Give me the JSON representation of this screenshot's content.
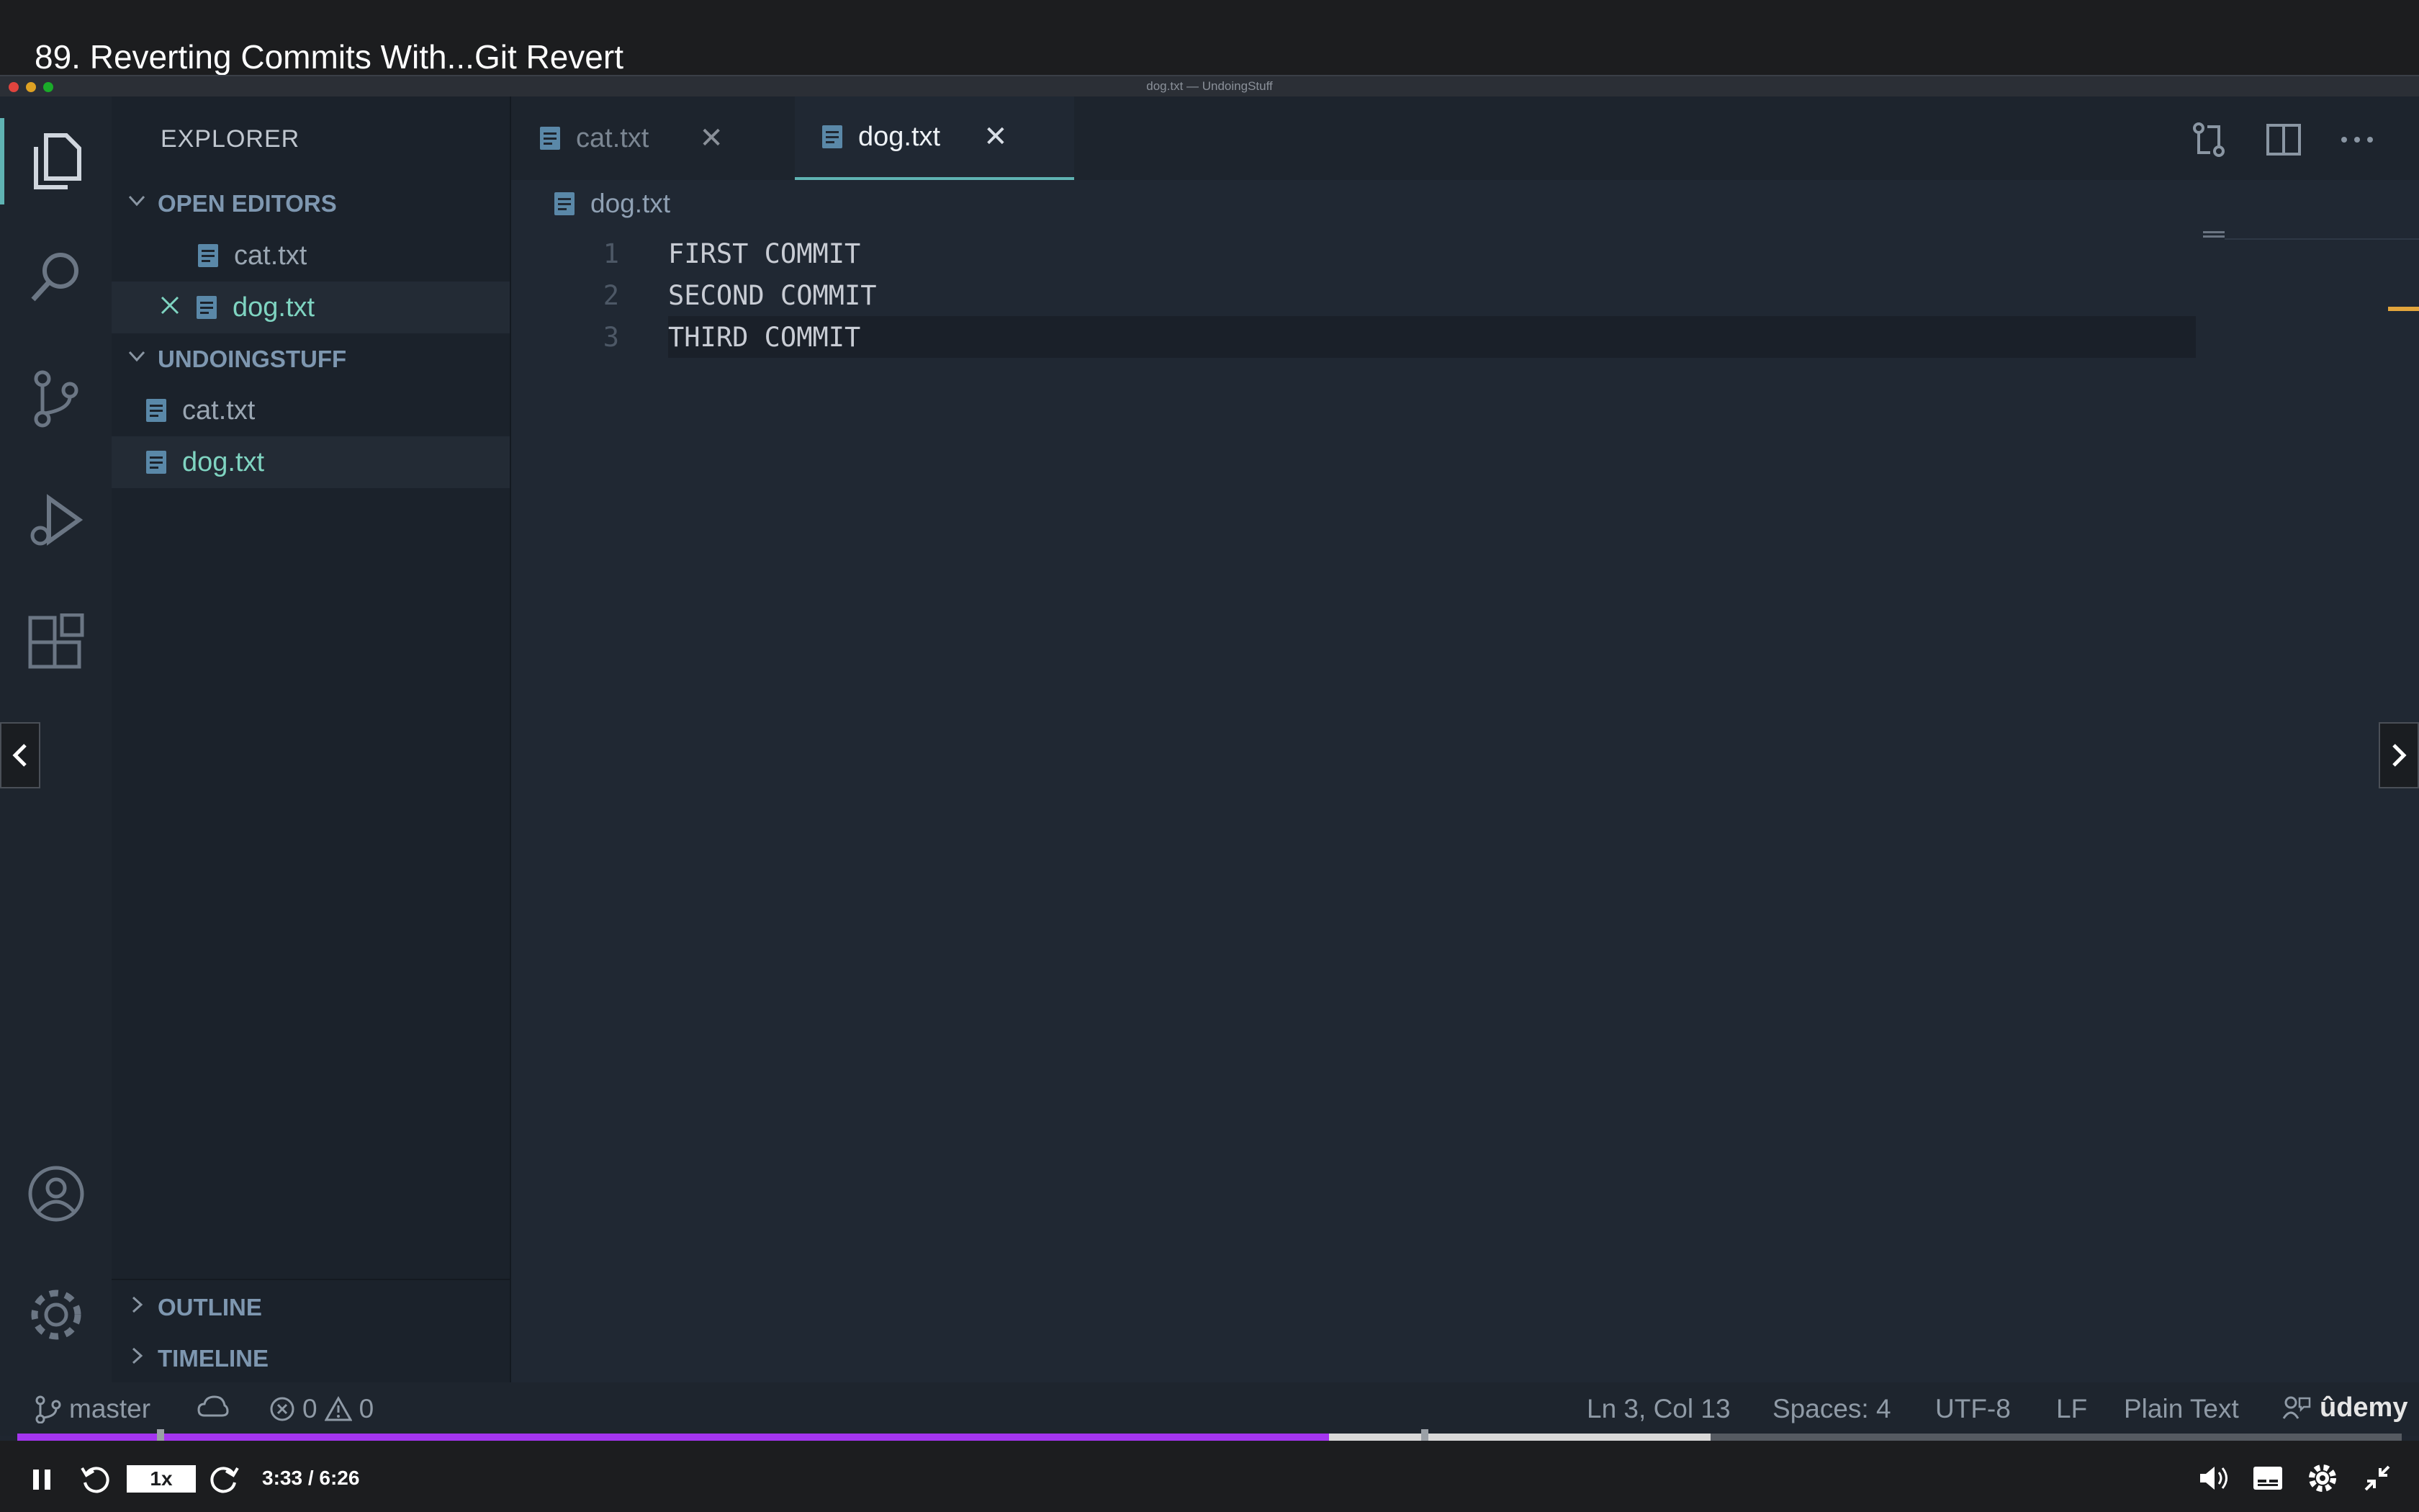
{
  "video": {
    "title": "89. Reverting Commits With...Git Revert",
    "speed": "1x",
    "time": "3:33 / 6:26",
    "progress_played": 0.55,
    "progress_buffered": 0.71,
    "watermark": "ûdemy"
  },
  "window": {
    "title": "dog.txt — UndoingStuff"
  },
  "activity": {
    "icons": [
      "explorer-icon",
      "search-icon",
      "source-control-icon",
      "run-debug-icon",
      "extensions-icon",
      "account-icon",
      "settings-gear-icon"
    ]
  },
  "sidebar": {
    "title": "EXPLORER",
    "open_editors": {
      "header": "OPEN EDITORS",
      "items": [
        {
          "label": "cat.txt"
        },
        {
          "label": "dog.txt"
        }
      ]
    },
    "folder": {
      "header": "UNDOINGSTUFF",
      "items": [
        {
          "label": "cat.txt"
        },
        {
          "label": "dog.txt"
        }
      ]
    },
    "outline": "OUTLINE",
    "timeline": "TIMELINE"
  },
  "editor": {
    "tabs": [
      {
        "label": "cat.txt",
        "active": false
      },
      {
        "label": "dog.txt",
        "active": true
      }
    ],
    "breadcrumb": "dog.txt",
    "lines": [
      {
        "number": "1",
        "text": "FIRST COMMIT"
      },
      {
        "number": "2",
        "text": "SECOND COMMIT"
      },
      {
        "number": "3",
        "text": "THIRD COMMIT"
      }
    ]
  },
  "statusbar": {
    "branch": "master",
    "errors": "0",
    "warnings": "0",
    "cursor": "Ln 3, Col 13",
    "spaces": "Spaces: 4",
    "encoding": "UTF-8",
    "eol": "LF",
    "language": "Plain Text"
  },
  "colors": {
    "accent_teal": "#5fb3b3",
    "file_green": "#7fd4c1",
    "progress_purple": "#a435f0",
    "scroll_marker": "#e2a53c"
  }
}
